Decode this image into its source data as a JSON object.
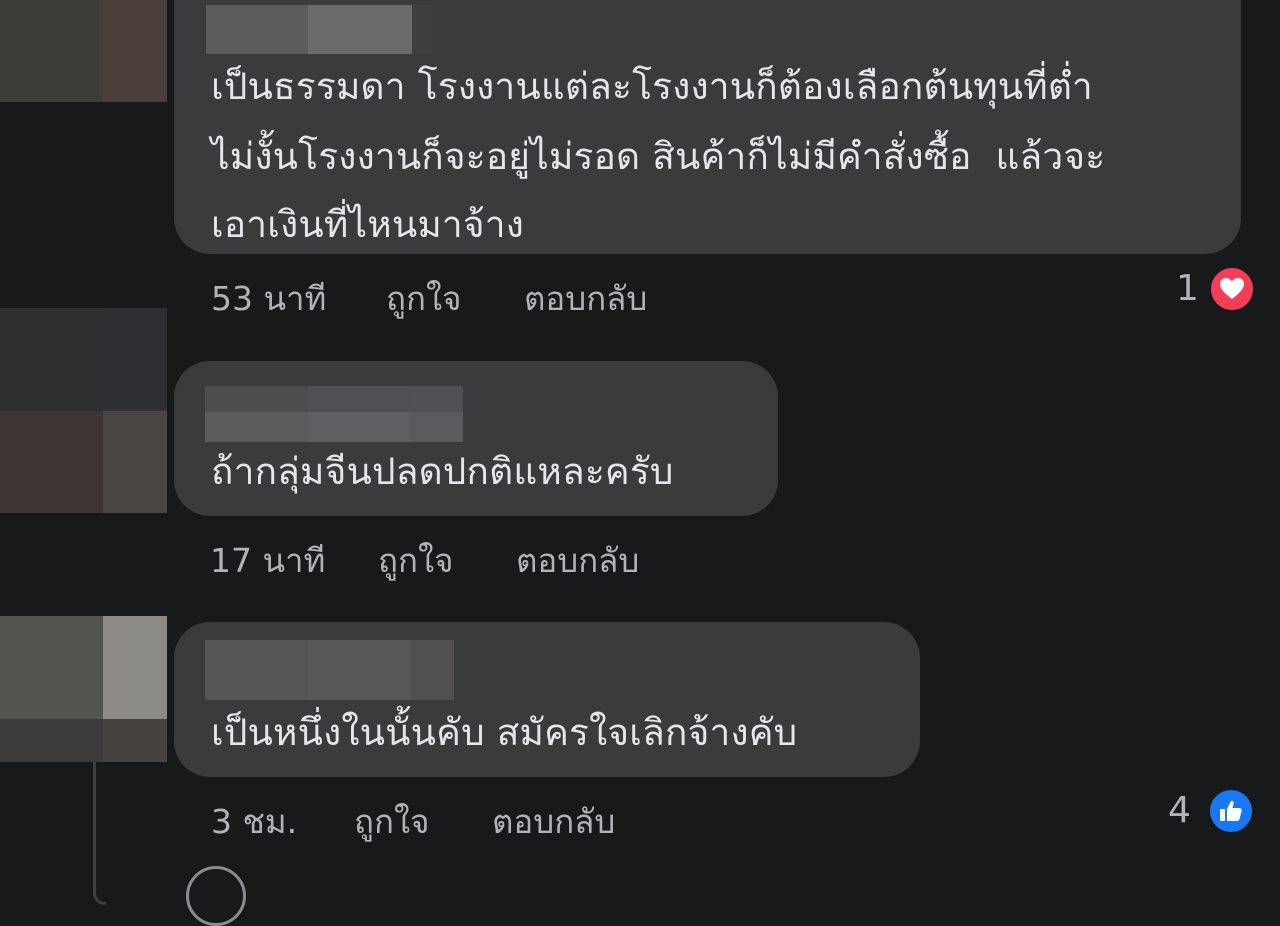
{
  "comments": [
    {
      "lines": [
        "เป็นธรรมดา โรงงานแต่ละโรงงานก็ต้องเลือกต้นทุนที่ต่ำ",
        "ไม่งั้นโรงงานก็จะอยู่ไม่รอด สินค้าก็ไม่มีคำสั่งซื้อ  แล้วจะ",
        "เอาเงินที่ไหนมาจ้าง"
      ],
      "time": "53 นาที",
      "like_label": "ถูกใจ",
      "reply_label": "ตอบกลับ",
      "reaction_count": "1",
      "reaction_icon": "love-reaction-icon"
    },
    {
      "lines": [
        "ถ้ากลุ่มจีนปลดปกติแหละครับ"
      ],
      "time": "17 นาที",
      "like_label": "ถูกใจ",
      "reply_label": "ตอบกลับ"
    },
    {
      "lines": [
        "เป็นหนึ่งในนั้นคับ สมัครใจเลิกจ้างคับ"
      ],
      "time": "3 ชม.",
      "like_label": "ถูกใจ",
      "reply_label": "ตอบกลับ",
      "reaction_count": "4",
      "reaction_icon": "like-reaction-icon"
    }
  ],
  "colors": {
    "background": "#18191a",
    "bubble": "#3a3b3c",
    "text": "#e4e6eb",
    "meta": "#b0b3b8",
    "love": "#f33e58",
    "like": "#1877f2"
  }
}
